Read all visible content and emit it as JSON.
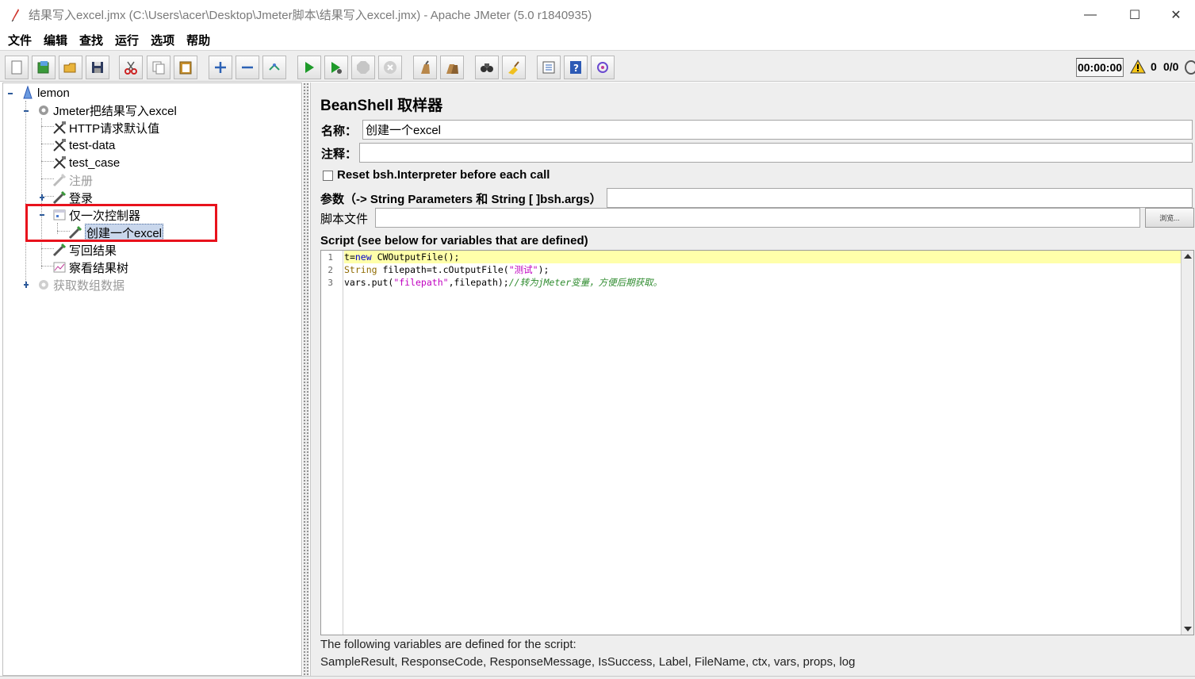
{
  "window": {
    "title": "结果写入excel.jmx (C:\\Users\\acer\\Desktop\\Jmeter脚本\\结果写入excel.jmx) - Apache JMeter (5.0 r1840935)",
    "minimize": "—",
    "maximize": "☐",
    "close": "✕"
  },
  "menu": [
    "文件",
    "编辑",
    "查找",
    "运行",
    "选项",
    "帮助"
  ],
  "toolbar": {
    "icons": [
      "new-icon",
      "templates-icon",
      "open-icon",
      "save-icon",
      "cut-icon",
      "copy-icon",
      "paste-icon",
      "expand-icon",
      "collapse-icon",
      "toggle-icon",
      "start-icon",
      "start-no-pause-icon",
      "stop-icon",
      "shutdown-icon",
      "clear-icon",
      "clear-all-icon",
      "search-icon",
      "reset-search-icon",
      "function-helper-icon",
      "help-icon",
      "remote-icon"
    ],
    "timer": "00:00:00",
    "warning_count": "0",
    "thread_count": "0/0"
  },
  "tree": {
    "nodes": [
      {
        "label": "lemon",
        "icon": "test-plan-icon"
      },
      {
        "label": "Jmeter把结果写入excel",
        "icon": "thread-group-icon"
      },
      {
        "label": "HTTP请求默认值",
        "icon": "config-element-icon"
      },
      {
        "label": "test-data",
        "icon": "config-element-icon"
      },
      {
        "label": "test_case",
        "icon": "config-element-icon"
      },
      {
        "label": "注册",
        "icon": "sampler-icon",
        "disabled": true
      },
      {
        "label": "登录",
        "icon": "sampler-icon"
      },
      {
        "label": "仅一次控制器",
        "icon": "controller-icon"
      },
      {
        "label": "创建一个excel",
        "icon": "sampler-icon",
        "selected": true
      },
      {
        "label": "写回结果",
        "icon": "sampler-icon"
      },
      {
        "label": "察看结果树",
        "icon": "listener-icon"
      },
      {
        "label": "获取数组数据",
        "icon": "thread-group-icon",
        "disabled": true
      }
    ]
  },
  "panel": {
    "title": "BeanShell 取样器",
    "name_label": "名称：",
    "name_value": "创建一个excel",
    "comment_label": "注释：",
    "comment_value": "",
    "reset_label": "Reset bsh.Interpreter before each call",
    "params_label": "参数（-> String Parameters 和 String [ ]bsh.args）",
    "params_value": "",
    "script_file_label": "脚本文件",
    "script_file_value": "",
    "browse_label": "浏览...",
    "script_header": "Script (see below for variables that are defined)",
    "code_lines": [
      {
        "num": "1",
        "parts": [
          [
            "t",
            ""
          ],
          [
            "=",
            ""
          ],
          [
            "new ",
            "kw"
          ],
          [
            "CWOutputFile();",
            ""
          ]
        ]
      },
      {
        "num": "2",
        "parts": [
          [
            "String ",
            "tp"
          ],
          [
            "filepath=t.cOutputFile(",
            ""
          ],
          [
            "\"测试\"",
            "str"
          ],
          [
            ");",
            ""
          ]
        ]
      },
      {
        "num": "3",
        "parts": [
          [
            "vars.put(",
            ""
          ],
          [
            "\"filepath\"",
            "str"
          ],
          [
            ",filepath);",
            ""
          ],
          [
            "//转为jMeter变量，方便后期获取。",
            "cm"
          ]
        ]
      }
    ],
    "footer_1": "The following variables are defined for the script:",
    "footer_2": "SampleResult, ResponseCode, ResponseMessage, IsSuccess, Label, FileName, ctx, vars, props, log"
  }
}
